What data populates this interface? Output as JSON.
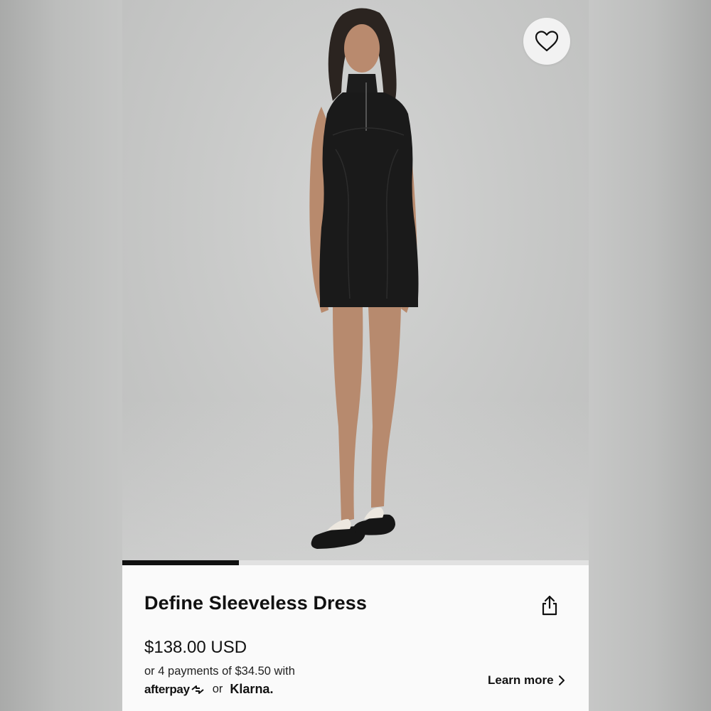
{
  "product": {
    "title": "Define Sleeveless Dress",
    "price": "$138.00 USD",
    "installments_text": "or 4 payments of $34.50 with",
    "provider_afterpay": "afterpay",
    "provider_separator": "or",
    "provider_klarna": "Klarna.",
    "learn_more_label": "Learn more",
    "image_alt": "Model wearing black sleeveless dress with half-zip and white flip-flops"
  },
  "gallery": {
    "progress_fraction": 0.25
  },
  "icons": {
    "wishlist": "heart-icon",
    "share": "share-icon",
    "learn_more": "chevron-right-icon",
    "afterpay_logo": "afterpay-arrows-icon"
  },
  "colors": {
    "text": "#111111",
    "progress_active": "#111111",
    "progress_track": "#e1e1e1",
    "hero_background": "#c9cac9"
  }
}
